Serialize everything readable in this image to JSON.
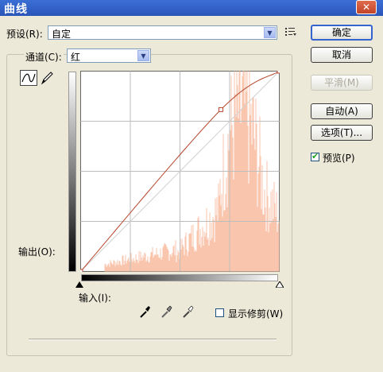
{
  "window": {
    "title": "曲线",
    "close_glyph": "✕"
  },
  "preset": {
    "label": "预设(R):",
    "value": "自定"
  },
  "channel": {
    "label": "通道(C):",
    "value": "红"
  },
  "buttons": {
    "ok": "确定",
    "cancel": "取消",
    "smooth": "平滑(M)",
    "auto": "自动(A)",
    "options": "选项(T)..."
  },
  "preview": {
    "label": "预览(P)",
    "checked": true
  },
  "show_clipping": {
    "label": "显示修剪(W)",
    "checked": false
  },
  "curves": {
    "output_label": "输出(O):",
    "input_label": "输入(I):",
    "curve_points": [
      [
        0,
        0
      ],
      [
        180,
        206
      ],
      [
        255,
        255
      ]
    ],
    "histogram_color": "#f9c6ad",
    "curve_color": "#b5452b"
  },
  "icons": {
    "preset_menu": "list-menu-icon",
    "curve_tool": "curve-tool-icon",
    "pencil_tool": "pencil-icon",
    "black_point": "black-eyedropper-icon",
    "gray_point": "gray-eyedropper-icon",
    "white_point": "white-eyedropper-icon"
  }
}
